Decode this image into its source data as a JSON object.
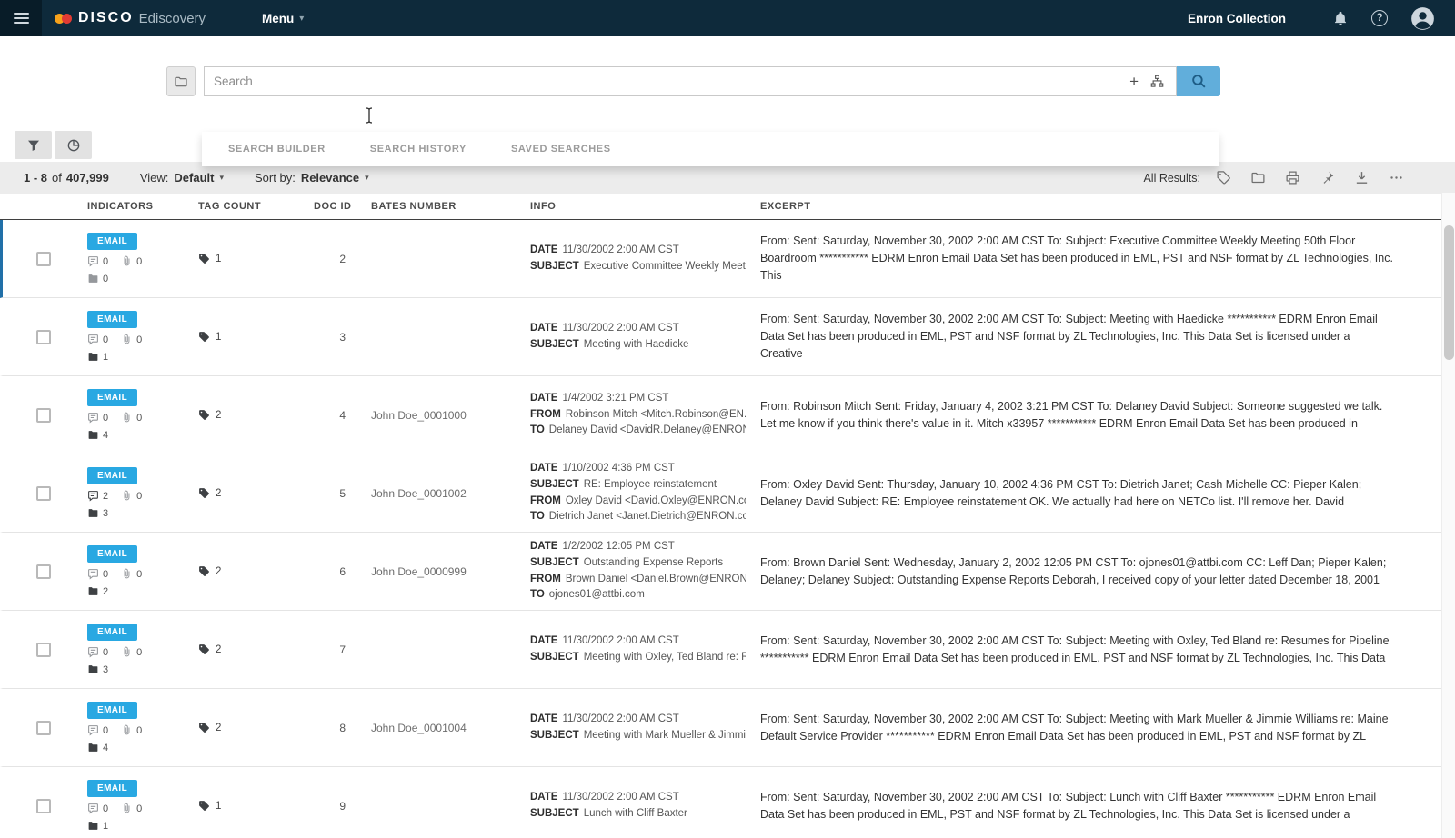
{
  "topbar": {
    "brand_name": "DISCO",
    "brand_product": "Ediscovery",
    "menu_label": "Menu",
    "collection_name": "Enron Collection"
  },
  "search": {
    "placeholder": "Search",
    "tabs": [
      {
        "label": "SEARCH BUILDER"
      },
      {
        "label": "SEARCH HISTORY"
      },
      {
        "label": "SAVED SEARCHES"
      }
    ]
  },
  "results_toolbar": {
    "range": "1 - 8",
    "of_label": "of",
    "total": "407,999",
    "view_label": "View:",
    "view_value": "Default",
    "sort_label": "Sort by:",
    "sort_value": "Relevance",
    "caret": "▾",
    "all_results_label": "All Results:"
  },
  "table": {
    "headers": [
      "INDICATORS",
      "TAG COUNT",
      "DOC ID",
      "BATES NUMBER",
      "INFO",
      "EXCERPT"
    ],
    "rows": [
      {
        "selected": true,
        "type_label": "EMAIL",
        "comment_count": "0",
        "attachment_count": "0",
        "folder_count": "0",
        "tag_count": "1",
        "doc_id": "2",
        "bates_number": "",
        "info": [
          {
            "label": "DATE",
            "value": "11/30/2002 2:00 AM CST"
          },
          {
            "label": "SUBJECT",
            "value": "Executive Committee Weekly Meeti..."
          }
        ],
        "excerpt": "From: Sent: Saturday, November 30, 2002 2:00 AM CST To: Subject: Executive Committee Weekly Meeting 50th Floor Boardroom *********** EDRM Enron Email Data Set has been produced in EML, PST and NSF format by ZL Technologies, Inc. This"
      },
      {
        "selected": false,
        "type_label": "EMAIL",
        "comment_count": "0",
        "attachment_count": "0",
        "folder_count": "1",
        "tag_count": "1",
        "doc_id": "3",
        "bates_number": "",
        "info": [
          {
            "label": "DATE",
            "value": "11/30/2002 2:00 AM CST"
          },
          {
            "label": "SUBJECT",
            "value": "Meeting with Haedicke"
          }
        ],
        "excerpt": "From: Sent: Saturday, November 30, 2002 2:00 AM CST To: Subject: Meeting with Haedicke *********** EDRM Enron Email Data Set has been produced in EML, PST and NSF format by ZL Technologies, Inc. This Data Set is licensed under a Creative"
      },
      {
        "selected": false,
        "type_label": "EMAIL",
        "comment_count": "0",
        "attachment_count": "0",
        "folder_count": "4",
        "tag_count": "2",
        "doc_id": "4",
        "bates_number": "John Doe_0001000",
        "info": [
          {
            "label": "DATE",
            "value": "1/4/2002 3:21 PM CST"
          },
          {
            "label": "FROM",
            "value": "Robinson Mitch <Mitch.Robinson@EN..."
          },
          {
            "label": "TO",
            "value": "Delaney David <DavidR.Delaney@ENRON...."
          }
        ],
        "excerpt": "From: Robinson Mitch Sent: Friday, January 4, 2002 3:21 PM CST To: Delaney David Subject: Someone suggested we talk. Let me know if you think there's value in it. Mitch x33957 *********** EDRM Enron Email Data Set has been produced in"
      },
      {
        "selected": false,
        "type_label": "EMAIL",
        "comment_count": "2",
        "attachment_count": "0",
        "folder_count": "3",
        "tag_count": "2",
        "doc_id": "5",
        "bates_number": "John Doe_0001002",
        "info": [
          {
            "label": "DATE",
            "value": "1/10/2002 4:36 PM CST"
          },
          {
            "label": "SUBJECT",
            "value": "RE: Employee reinstatement"
          },
          {
            "label": "FROM",
            "value": "Oxley David <David.Oxley@ENRON.co..."
          },
          {
            "label": "TO",
            "value": "Dietrich Janet <Janet.Dietrich@ENRON.co..."
          }
        ],
        "excerpt": "From: Oxley David Sent: Thursday, January 10, 2002 4:36 PM CST To: Dietrich Janet; Cash Michelle CC: Pieper Kalen; Delaney David Subject: RE: Employee reinstatement OK. We actually had here on NETCo list. I'll remove her. David"
      },
      {
        "selected": false,
        "type_label": "EMAIL",
        "comment_count": "0",
        "attachment_count": "0",
        "folder_count": "2",
        "tag_count": "2",
        "doc_id": "6",
        "bates_number": "John Doe_0000999",
        "info": [
          {
            "label": "DATE",
            "value": "1/2/2002 12:05 PM CST"
          },
          {
            "label": "SUBJECT",
            "value": "Outstanding Expense Reports"
          },
          {
            "label": "FROM",
            "value": "Brown Daniel <Daniel.Brown@ENRON..."
          },
          {
            "label": "TO",
            "value": "ojones01@attbi.com"
          }
        ],
        "excerpt": "From: Brown Daniel Sent: Wednesday, January 2, 2002 12:05 PM CST To: ojones01@attbi.com CC: Leff Dan; Pieper Kalen; Delaney; Delaney Subject: Outstanding Expense Reports Deborah, I received copy of your letter dated December 18, 2001"
      },
      {
        "selected": false,
        "type_label": "EMAIL",
        "comment_count": "0",
        "attachment_count": "0",
        "folder_count": "3",
        "tag_count": "2",
        "doc_id": "7",
        "bates_number": "",
        "info": [
          {
            "label": "DATE",
            "value": "11/30/2002 2:00 AM CST"
          },
          {
            "label": "SUBJECT",
            "value": "Meeting with Oxley, Ted Bland re: R..."
          }
        ],
        "excerpt": "From: Sent: Saturday, November 30, 2002 2:00 AM CST To: Subject: Meeting with Oxley, Ted Bland re: Resumes for Pipeline *********** EDRM Enron Email Data Set has been produced in EML, PST and NSF format by ZL Technologies, Inc. This Data"
      },
      {
        "selected": false,
        "type_label": "EMAIL",
        "comment_count": "0",
        "attachment_count": "0",
        "folder_count": "4",
        "tag_count": "2",
        "doc_id": "8",
        "bates_number": "John Doe_0001004",
        "info": [
          {
            "label": "DATE",
            "value": "11/30/2002 2:00 AM CST"
          },
          {
            "label": "SUBJECT",
            "value": "Meeting with Mark Mueller & Jimmi..."
          }
        ],
        "excerpt": "From: Sent: Saturday, November 30, 2002 2:00 AM CST To: Subject: Meeting with Mark Mueller & Jimmie Williams re: Maine Default Service Provider *********** EDRM Enron Email Data Set has been produced in EML, PST and NSF format by ZL"
      },
      {
        "selected": false,
        "type_label": "EMAIL",
        "comment_count": "0",
        "attachment_count": "0",
        "folder_count": "1",
        "tag_count": "1",
        "doc_id": "9",
        "bates_number": "",
        "info": [
          {
            "label": "DATE",
            "value": "11/30/2002 2:00 AM CST"
          },
          {
            "label": "SUBJECT",
            "value": "Lunch with Cliff Baxter"
          }
        ],
        "excerpt": "From: Sent: Saturday, November 30, 2002 2:00 AM CST To: Subject: Lunch with Cliff Baxter *********** EDRM Enron Email Data Set has been produced in EML, PST and NSF format by ZL Technologies, Inc. This Data Set is licensed under a"
      }
    ]
  },
  "colors": {
    "topbar_bg": "#0e2a3b",
    "badge_blue": "#29a8e2",
    "selected_row_accent": "#2170a8",
    "search_button_blue": "#61aedb"
  }
}
